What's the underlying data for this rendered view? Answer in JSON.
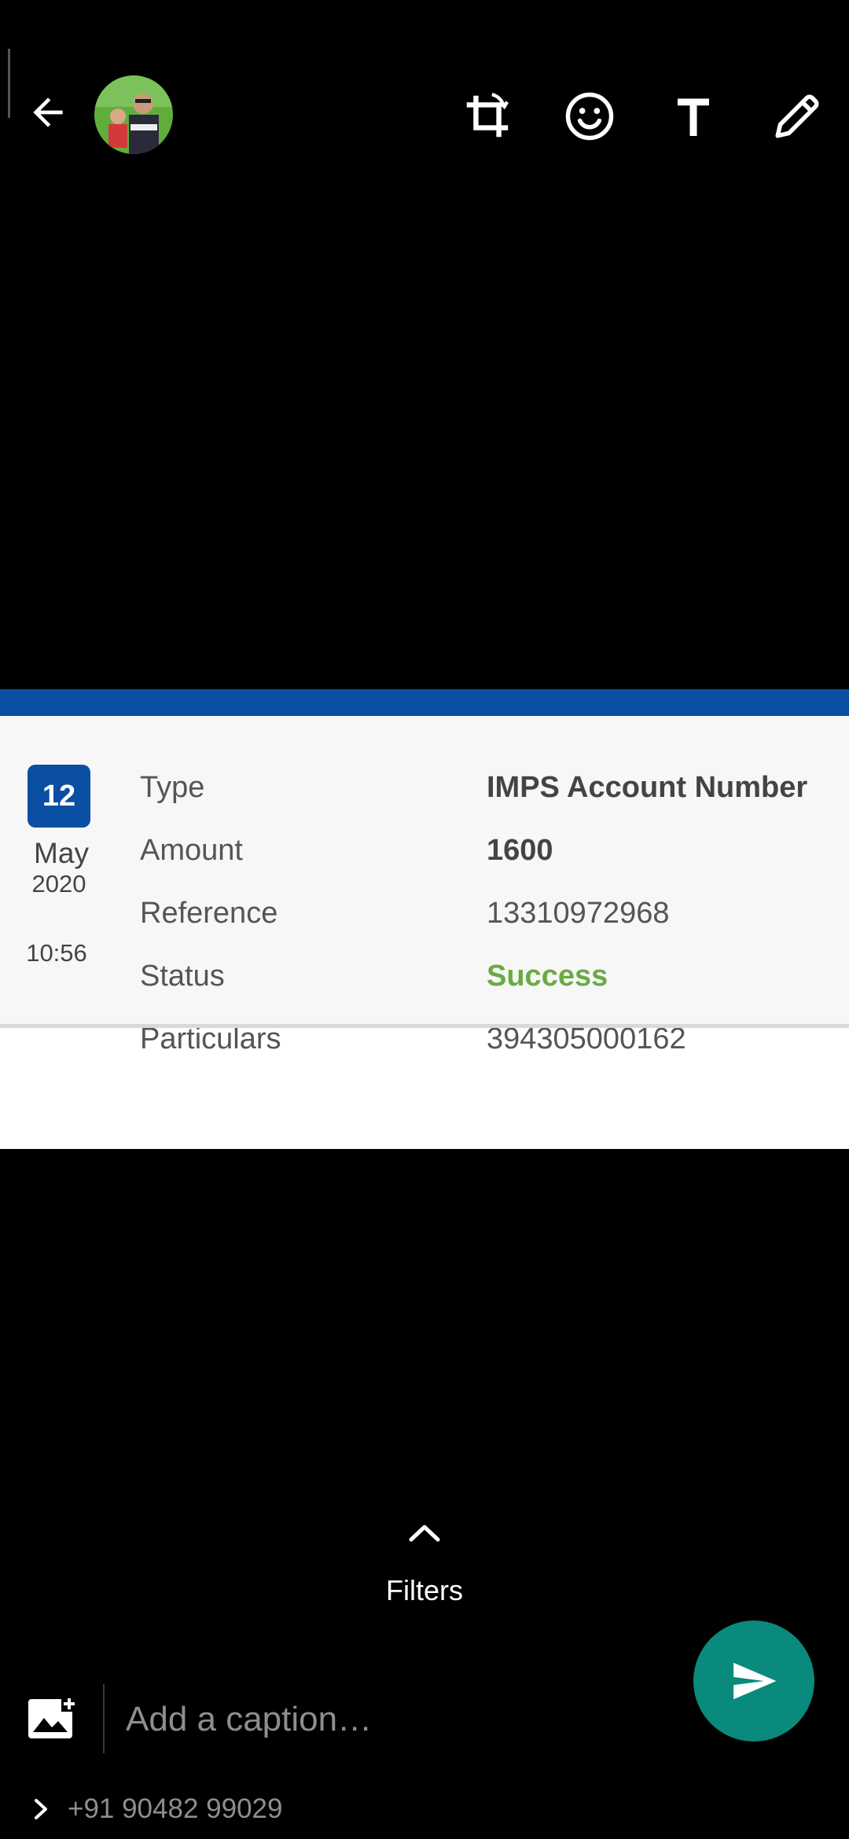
{
  "toolbar": {
    "back_icon": "arrow-left-icon",
    "avatar": "contact-avatar",
    "tools": [
      "crop-rotate-icon",
      "emoji-icon",
      "text-icon",
      "pencil-icon"
    ]
  },
  "transaction": {
    "date_day": "12",
    "date_month": "May",
    "date_year": "2020",
    "time": "10:56",
    "rows": [
      {
        "label": "Type",
        "value": "IMPS Account Number"
      },
      {
        "label": "Amount",
        "value": "1600"
      },
      {
        "label": "Reference",
        "value": "13310972968"
      },
      {
        "label": "Status",
        "value": "Success"
      },
      {
        "label": "Particulars",
        "value": "394305000162"
      }
    ]
  },
  "filters": {
    "label": "Filters",
    "icon": "chevron-up-icon"
  },
  "caption": {
    "placeholder": "Add a caption…",
    "value": ""
  },
  "recipient": {
    "label": "+91 90482 99029"
  },
  "colors": {
    "accent_blue": "#0a4fa3",
    "success_green": "#6aab43",
    "send_teal": "#0a8a7c"
  }
}
